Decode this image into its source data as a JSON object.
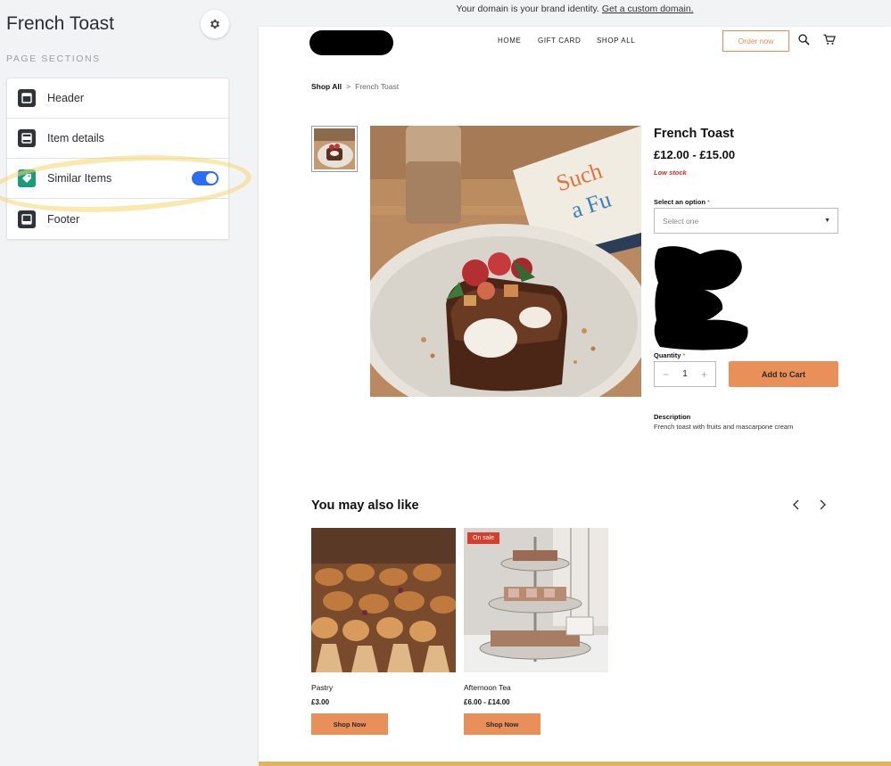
{
  "editor": {
    "title": "French Toast",
    "sections_label": "PAGE SECTIONS",
    "sections": [
      {
        "label": "Header",
        "icon": "header-section-icon"
      },
      {
        "label": "Item details",
        "icon": "item-details-section-icon"
      },
      {
        "label": "Similar Items",
        "icon": "tag-icon",
        "toggle_on": true
      },
      {
        "label": "Footer",
        "icon": "footer-section-icon"
      }
    ]
  },
  "banner": {
    "text": "Your domain is your brand identity.",
    "link": "Get a custom domain."
  },
  "site_nav": {
    "items": [
      "HOME",
      "GIFT CARD",
      "SHOP ALL"
    ],
    "order_button": "Order now"
  },
  "breadcrumb": {
    "root": "Shop All",
    "separator": ">",
    "current": "French Toast"
  },
  "product": {
    "title": "French Toast",
    "price": "£12.00 - £15.00",
    "stock": "Low stock",
    "option_label": "Select an option",
    "option_placeholder": "Select one",
    "quantity_label": "Quantity",
    "required_mark": "*",
    "quantity": "1",
    "add_to_cart": "Add to Cart",
    "description_label": "Description",
    "description": "French toast with fruits and mascarpone cream"
  },
  "similar": {
    "heading": "You may also like",
    "items": [
      {
        "name": "Pastry",
        "price": "£3.00",
        "button": "Shop Now"
      },
      {
        "name": "Afternoon Tea",
        "price": "£6.00 - £14.00",
        "button": "Shop Now",
        "badge": "On sale"
      }
    ]
  },
  "colors": {
    "accent_orange": "#e98f5a",
    "toggle_blue": "#2b6ef3",
    "sale_red": "#d63f2f",
    "stock_red": "#d62d20",
    "footer_bar": "#e0b35d"
  }
}
